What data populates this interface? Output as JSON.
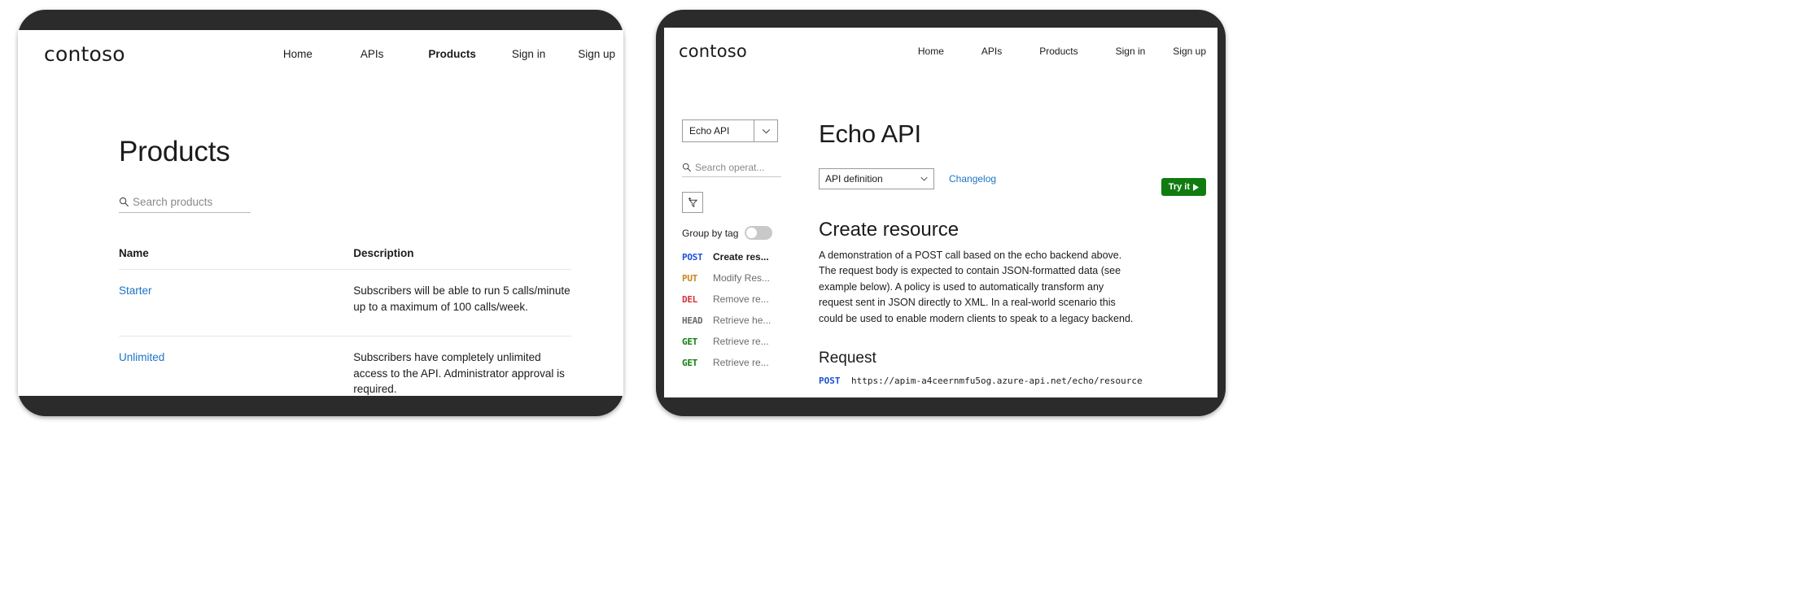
{
  "brand": {
    "name": "contoso"
  },
  "nav": {
    "items": [
      {
        "label": "Home",
        "active": false
      },
      {
        "label": "APIs",
        "active": false
      },
      {
        "label": "Products",
        "active": true
      },
      {
        "label": "Sign in",
        "active": false
      },
      {
        "label": "Sign up",
        "active": false
      }
    ]
  },
  "left_panel": {
    "page_title": "Products",
    "search": {
      "placeholder": "Search products",
      "value": ""
    },
    "table": {
      "columns": [
        "Name",
        "Description"
      ],
      "rows": [
        {
          "name": "Starter",
          "description": "Subscribers will be able to run 5 calls/minute up to a maximum of 100 calls/week."
        },
        {
          "name": "Unlimited",
          "description": "Subscribers have completely unlimited access to the API. Administrator approval is required."
        }
      ]
    }
  },
  "right_panel": {
    "api_selector": {
      "value": "Echo API",
      "icon": "chevron-down-icon"
    },
    "operations_search": {
      "placeholder": "Search operat...",
      "value": ""
    },
    "filter_button": {
      "icon": "add-filter-icon"
    },
    "group_by_tag": {
      "label": "Group by tag",
      "enabled": false
    },
    "operations": [
      {
        "verb": "POST",
        "name": "Create res...",
        "color": "#1b4fd8",
        "selected": true
      },
      {
        "verb": "PUT",
        "name": "Modify Res...",
        "color": "#c8851a",
        "selected": false
      },
      {
        "verb": "DEL",
        "name": "Remove re...",
        "color": "#d13438",
        "selected": false
      },
      {
        "verb": "HEAD",
        "name": "Retrieve he...",
        "color": "#6b6b6b",
        "selected": false
      },
      {
        "verb": "GET",
        "name": "Retrieve re...",
        "color": "#107c10",
        "selected": false
      },
      {
        "verb": "GET",
        "name": "Retrieve re...",
        "color": "#107c10",
        "selected": false
      }
    ],
    "api_title": "Echo API",
    "definition_select": {
      "value": "API definition",
      "icon": "chevron-down-icon"
    },
    "changelog_link": "Changelog",
    "try_it_button": {
      "label": "Try it",
      "icon": "play-icon",
      "color": "#107c10"
    },
    "operation_heading": "Create resource",
    "operation_description": "A demonstration of a POST call based on the echo backend above. The request body is expected to contain JSON-formatted data (see example below). A policy is used to automatically transform any request sent in JSON directly to XML. In a real-world scenario this could be used to enable modern clients to speak to a legacy backend.",
    "request_heading": "Request",
    "request": {
      "verb": "POST",
      "url": "https://apim-a4ceernmfu5og.azure-api.net/echo/resource"
    }
  }
}
